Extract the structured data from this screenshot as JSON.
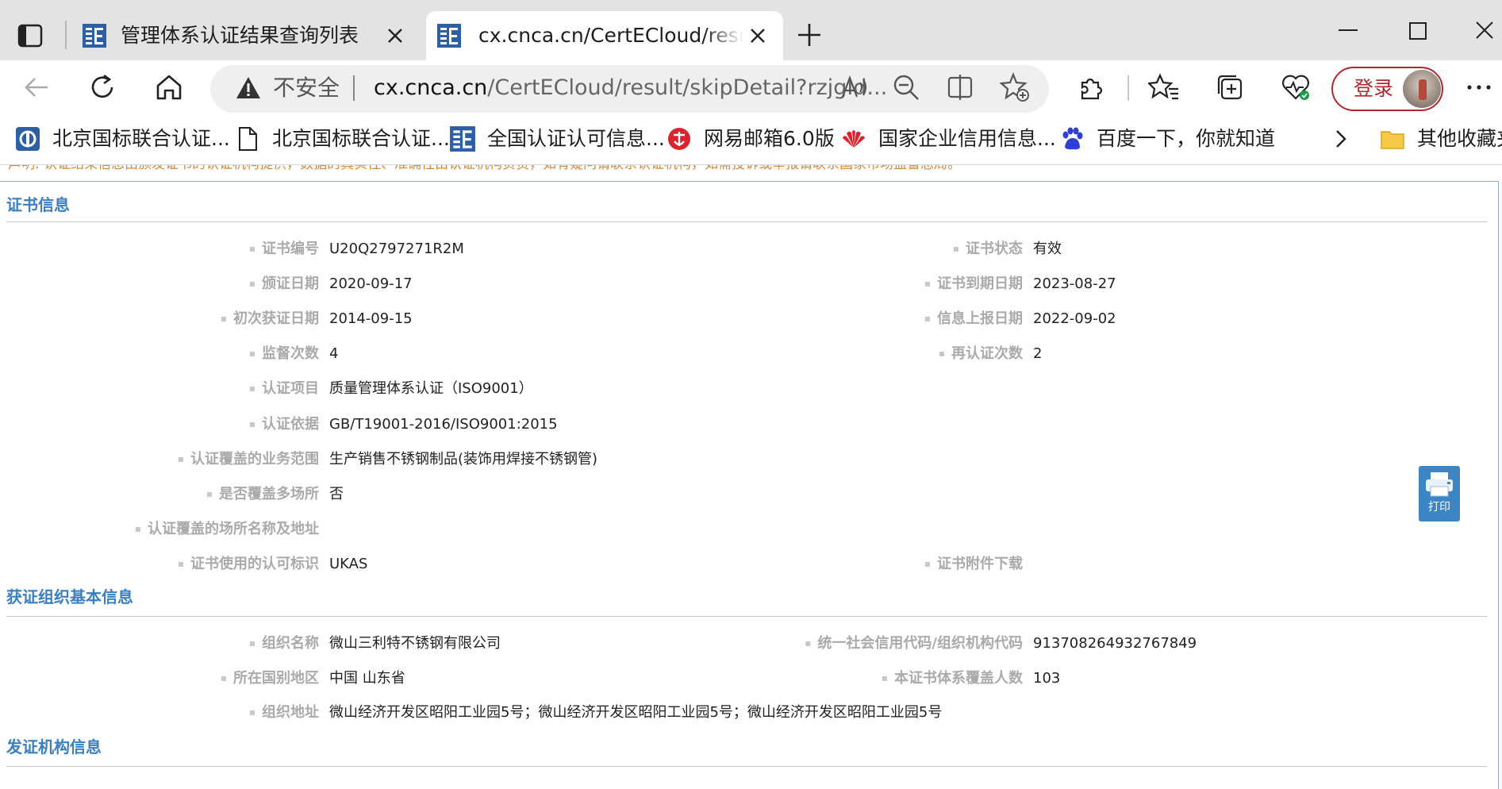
{
  "browser": {
    "tabs": [
      {
        "title": "管理体系认证结果查询列表",
        "active": false
      },
      {
        "title": "cx.cnca.cn/CertECloud/result/skipDetail?rzjgId=",
        "active": true
      }
    ],
    "address": {
      "security_label": "不安全",
      "url_host": "cx.cnca.cn",
      "url_path": "/CertECloud/result/skipDetail?rzjgId..."
    },
    "login_label": "登录",
    "bookmarks": [
      {
        "label": "北京国标联合认证...",
        "icon": "bookmark-site-icon"
      },
      {
        "label": "北京国标联合认证...",
        "icon": "document-icon"
      },
      {
        "label": "全国认证认可信息...",
        "icon": "cnca-icon"
      },
      {
        "label": "网易邮箱6.0版",
        "icon": "netease-mail-icon"
      },
      {
        "label": "国家企业信用信息...",
        "icon": "huawei-icon"
      },
      {
        "label": "百度一下，你就知道",
        "icon": "baidu-icon"
      }
    ],
    "other_bookmarks_label": "其他收藏夹",
    "accent_color": "#b3262e"
  },
  "page": {
    "notice": "声明: 认证结果信息由颁发证书的认证机构提供，数据的真实性、准确性由认证机构负责，如有疑问请联系认证机构，如需投诉或举报请联系国家市场监督总局。",
    "print_label": "打印",
    "sections": {
      "cert": {
        "title": "证书信息",
        "fields": {
          "cert_no": {
            "label": "证书编号",
            "value": "U20Q2797271R2M"
          },
          "cert_status": {
            "label": "证书状态",
            "value": "有效"
          },
          "issue_date": {
            "label": "颁证日期",
            "value": "2020-09-17"
          },
          "expire_date": {
            "label": "证书到期日期",
            "value": "2023-08-27"
          },
          "first_date": {
            "label": "初次获证日期",
            "value": "2014-09-15"
          },
          "report_date": {
            "label": "信息上报日期",
            "value": "2022-09-02"
          },
          "audit_count": {
            "label": "监督次数",
            "value": "4"
          },
          "recert_count": {
            "label": "再认证次数",
            "value": "2"
          },
          "project": {
            "label": "认证项目",
            "value": "质量管理体系认证（ISO9001）"
          },
          "basis": {
            "label": "认证依据",
            "value": "GB/T19001-2016/ISO9001:2015"
          },
          "scope": {
            "label": "认证覆盖的业务范围",
            "value": "生产销售不锈钢制品(装饰用焊接不锈钢管)"
          },
          "multi_site": {
            "label": "是否覆盖多场所",
            "value": "否"
          },
          "sites": {
            "label": "认证覆盖的场所名称及地址",
            "value": ""
          },
          "accreditation": {
            "label": "证书使用的认可标识",
            "value": "UKAS"
          },
          "attachment": {
            "label": "证书附件下载",
            "value": ""
          }
        }
      },
      "org": {
        "title": "获证组织基本信息",
        "fields": {
          "org_name": {
            "label": "组织名称",
            "value": "微山三利特不锈钢有限公司"
          },
          "credit_code": {
            "label": "统一社会信用代码/组织机构代码",
            "value": "913708264932767849"
          },
          "region": {
            "label": "所在国别地区",
            "value": "中国 山东省"
          },
          "headcount": {
            "label": "本证书体系覆盖人数",
            "value": "103"
          },
          "address": {
            "label": "组织地址",
            "value": "微山经济开发区昭阳工业园5号；微山经济开发区昭阳工业园5号；微山经济开发区昭阳工业园5号"
          }
        }
      },
      "issuer": {
        "title": "发证机构信息"
      }
    },
    "colors": {
      "section_title": "#3a7fc1",
      "label": "#aaaaaa",
      "notice": "#d58a3a",
      "print_button": "#3d86c6"
    }
  }
}
